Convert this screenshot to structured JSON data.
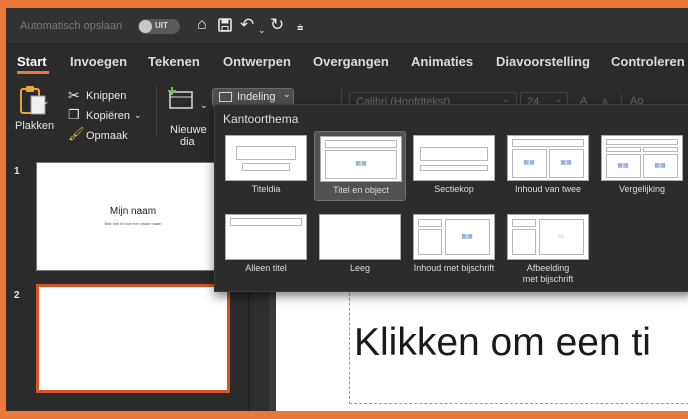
{
  "titlebar": {
    "autosave_label": "Automatisch opslaan",
    "autosave_state": "UIT",
    "icons": [
      "home-icon",
      "save-icon",
      "undo-icon",
      "redo-icon",
      "customize-icon"
    ]
  },
  "tabs": [
    "Start",
    "Invoegen",
    "Tekenen",
    "Ontwerpen",
    "Overgangen",
    "Animaties",
    "Diavoorstelling",
    "Controleren"
  ],
  "active_tab": "Start",
  "ribbon": {
    "paste_label": "Plakken",
    "cut_label": "Knippen",
    "copy_label": "Kopiëren",
    "format_label": "Opmaak",
    "new_slide_line1": "Nieuwe",
    "new_slide_line2": "dia",
    "layout_label": "Indeling",
    "font_name": "Calibri (Hoofdtekst)",
    "font_size": "24",
    "grow_font": "A",
    "shrink_font": "A",
    "clear_format": "Ao"
  },
  "layout_popup": {
    "heading": "Kantoorthema",
    "items": [
      {
        "label": "Titeldia"
      },
      {
        "label": "Titel en object"
      },
      {
        "label": "Sectiekop"
      },
      {
        "label": "Inhoud van twee"
      },
      {
        "label": "Vergelijking"
      },
      {
        "label": "Alleen titel"
      },
      {
        "label": "Leeg"
      },
      {
        "label": "Inhoud met bijschrift"
      },
      {
        "label_line1": "Afbeelding",
        "label_line2": "met bijschrift"
      }
    ],
    "selected": "Titel en object"
  },
  "slides": [
    {
      "number": "1",
      "title": "Mijn naam",
      "subtitle": "Wat heb ik toch een leuke naam"
    },
    {
      "number": "2"
    }
  ],
  "editor": {
    "title_placeholder": "Klikken om een ti"
  },
  "colors": {
    "accent": "#e8793a",
    "selection": "#d4552a"
  }
}
